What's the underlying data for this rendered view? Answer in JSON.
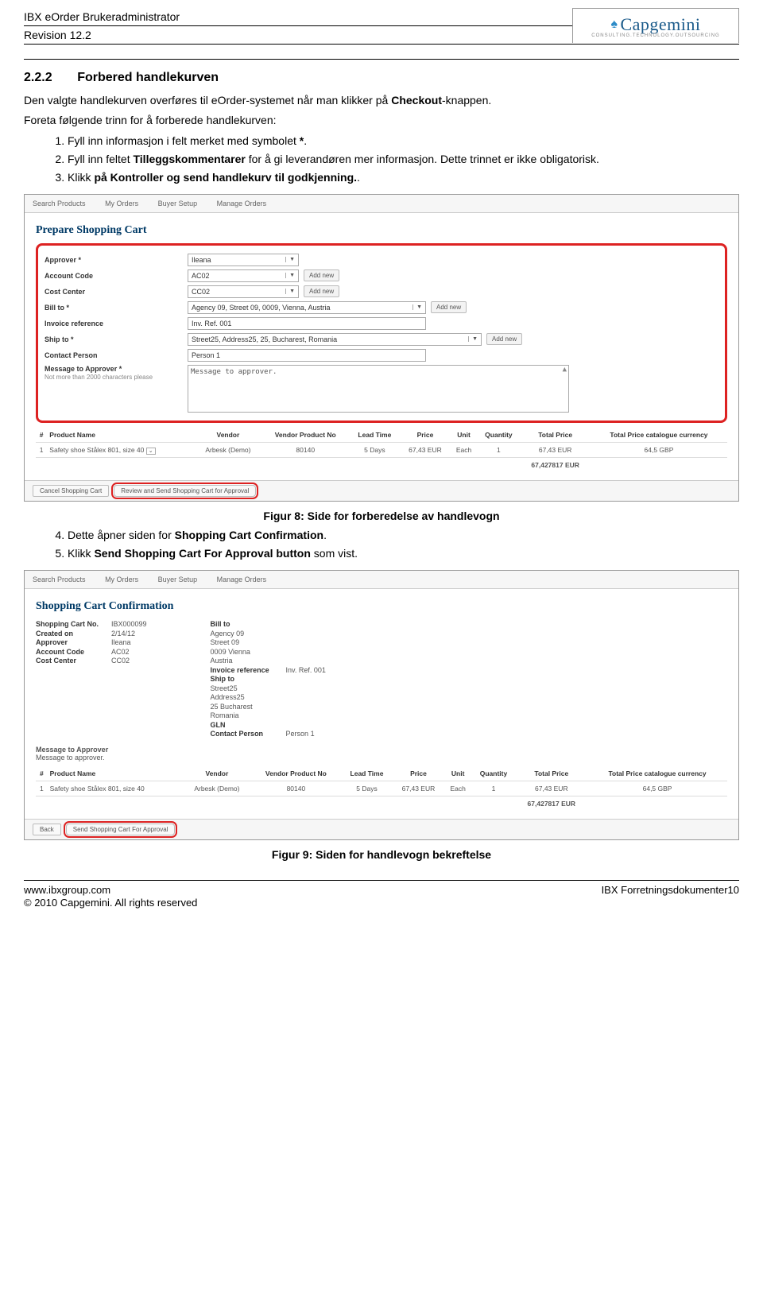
{
  "header": {
    "title": "IBX eOrder Brukeradministrator",
    "revision": "Revision 12.2",
    "logo_main": "Capgemini",
    "logo_sub": "CONSULTING.TECHNOLOGY.OUTSOURCING"
  },
  "section": {
    "num": "2.2.2",
    "title": "Forbered handlekurven"
  },
  "body": {
    "p1_a": "Den valgte handlekurven overføres til eOrder-systemet når man klikker på ",
    "p1_b": "Checkout",
    "p1_c": "-knappen.",
    "p2": "Foreta følgende trinn for å forberede handlekurven:",
    "steps1": {
      "s1_a": "Fyll inn informasjon i felt merket med symbolet ",
      "s1_b": "*",
      "s1_c": ".",
      "s2_a": "Fyll inn feltet ",
      "s2_b": "Tilleggskommentarer",
      "s2_c": " for å gi leverandøren mer informasjon. Dette trinnet er ikke obligatorisk.",
      "s3_a": "Klikk ",
      "s3_b": "på Kontroller og send handlekurv til godkjenning.",
      "s3_c": "."
    },
    "steps2": {
      "s4_a": "Dette åpner siden for ",
      "s4_b": "Shopping Cart Confirmation",
      "s4_c": ".",
      "s5_a": "Klikk ",
      "s5_b": "Send Shopping Cart For Approval button",
      "s5_c": " som vist."
    }
  },
  "captions": {
    "fig8": "Figur 8: Side for forberedelse av handlevogn",
    "fig9": "Figur 9: Siden for handlevogn bekreftelse"
  },
  "screenshot1": {
    "nav": [
      "Search Products",
      "My Orders",
      "Buyer Setup",
      "Manage Orders"
    ],
    "heading": "Prepare Shopping Cart",
    "fields": {
      "approver_l": "Approver *",
      "approver_v": "Ileana",
      "account_l": "Account Code",
      "account_v": "AC02",
      "cost_l": "Cost Center",
      "cost_v": "CC02",
      "bill_l": "Bill to *",
      "bill_v": "Agency  09, Street 09, 0009, Vienna, Austria",
      "invref_l": "Invoice reference",
      "invref_v": "Inv. Ref. 001",
      "ship_l": "Ship to *",
      "ship_v": "Street25, Address25, 25, Bucharest, Romania",
      "contact_l": "Contact Person",
      "contact_v": "Person 1",
      "msg_l": "Message to Approver *",
      "msg_sub": "Not more than 2000 characters please",
      "msg_v": "Message to approver.",
      "add_new": "Add new"
    },
    "table": {
      "headers": [
        "#",
        "Product Name",
        "Vendor",
        "Vendor Product No",
        "Lead Time",
        "Price",
        "Unit",
        "Quantity",
        "Total Price",
        "Total Price catalogue currency"
      ],
      "row": [
        "1",
        "Safety shoe Stålex 801, size 40",
        "Arbesk (Demo)",
        "80140",
        "5 Days",
        "67,43 EUR",
        "Each",
        "1",
        "67,43 EUR",
        "64,5 GBP"
      ],
      "total": "67,427817 EUR"
    },
    "footer": {
      "cancel": "Cancel Shopping Cart",
      "review": "Review and Send Shopping Cart for Approval"
    }
  },
  "screenshot2": {
    "nav": [
      "Search Products",
      "My Orders",
      "Buyer Setup",
      "Manage Orders"
    ],
    "heading": "Shopping Cart Confirmation",
    "left": {
      "cartno_l": "Shopping Cart No.",
      "cartno_v": "IBX000099",
      "created_l": "Created on",
      "created_v": "2/14/12",
      "approver_l": "Approver",
      "approver_v": "Ileana",
      "account_l": "Account Code",
      "account_v": "AC02",
      "cost_l": "Cost Center",
      "cost_v": "CC02"
    },
    "right": {
      "bill_l": "Bill to",
      "bill_v1": "Agency  09",
      "bill_v2": "Street 09",
      "bill_v3": "0009  Vienna",
      "bill_v4": "Austria",
      "invref_l": "Invoice reference",
      "invref_v": "Inv. Ref. 001",
      "ship_l": "Ship to",
      "ship_v1": "Street25",
      "ship_v2": "Address25",
      "ship_v3": "25  Bucharest",
      "ship_v4": "Romania",
      "gln_l": "GLN",
      "cp_l": "Contact Person",
      "cp_v": "Person 1"
    },
    "msg_l": "Message to Approver",
    "msg_v": "Message to approver.",
    "table": {
      "headers": [
        "#",
        "Product Name",
        "Vendor",
        "Vendor Product No",
        "Lead Time",
        "Price",
        "Unit",
        "Quantity",
        "Total Price",
        "Total Price catalogue currency"
      ],
      "row": [
        "1",
        "Safety shoe Stålex 801, size 40",
        "Arbesk (Demo)",
        "80140",
        "5 Days",
        "67,43 EUR",
        "Each",
        "1",
        "67,43 EUR",
        "64,5 GBP"
      ],
      "total": "67,427817 EUR"
    },
    "footer": {
      "back": "Back",
      "send": "Send Shopping Cart For Approval"
    }
  },
  "footer": {
    "url": "www.ibxgroup.com",
    "copyright": "© 2010 Capgemini. All rights reserved",
    "right": "IBX Forretningsdokumenter10"
  }
}
